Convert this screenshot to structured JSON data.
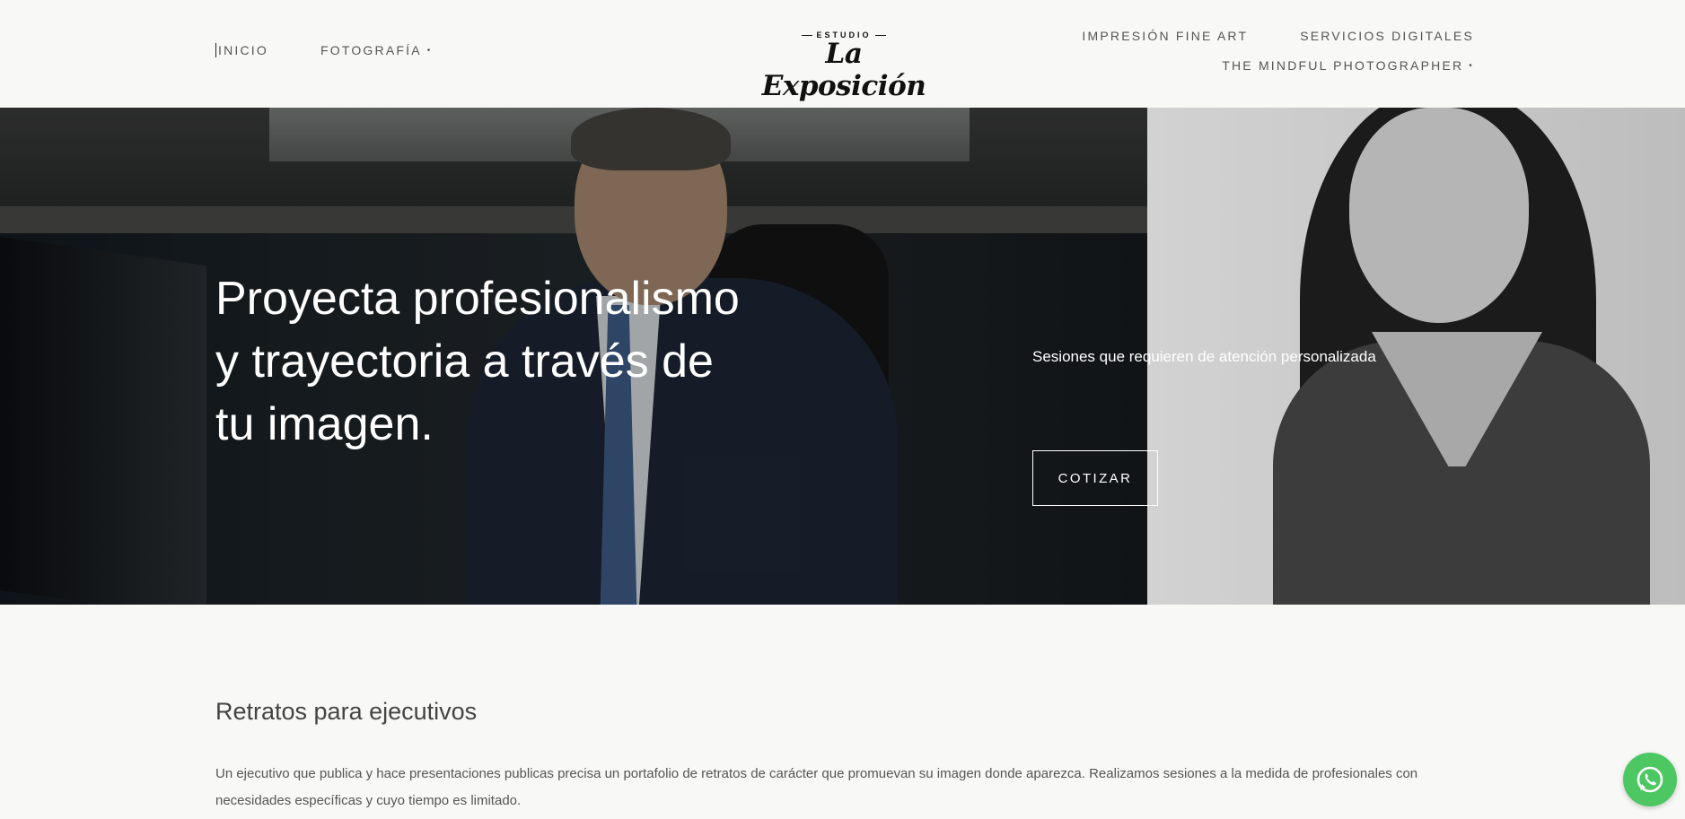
{
  "nav": {
    "left": [
      {
        "label": "INICIO"
      },
      {
        "label": "FOTOGRAFÍA",
        "dot": "•"
      }
    ],
    "right_row1": [
      {
        "label": "IMPRESIÓN FINE ART"
      },
      {
        "label": "SERVICIOS DIGITALES"
      }
    ],
    "right_row2": [
      {
        "label": "THE MINDFUL PHOTOGRAPHER",
        "dot": "•"
      }
    ]
  },
  "logo": {
    "small": "ESTUDIO",
    "script": "La Exposición"
  },
  "hero": {
    "title_line1": "Proyecta profesionalismo",
    "title_line2": "y trayectoria a través de",
    "title_line3": "tu imagen.",
    "subtitle": "Sesiones que requieren de atención personalizada",
    "cta_label": "COTIZAR"
  },
  "section": {
    "title": "Retratos para ejecutivos",
    "body": "Un ejecutivo que publica y hace presentaciones publicas precisa un portafolio de retratos de carácter que promuevan su imagen donde aparezca. Realizamos sesiones a la medida de profesionales con necesidades específicas y cuyo tiempo es limitado."
  },
  "colors": {
    "background": "#f8f8f6",
    "text": "#555555",
    "whatsapp": "#4cc761"
  },
  "icons": {
    "whatsapp": "whatsapp-icon"
  }
}
